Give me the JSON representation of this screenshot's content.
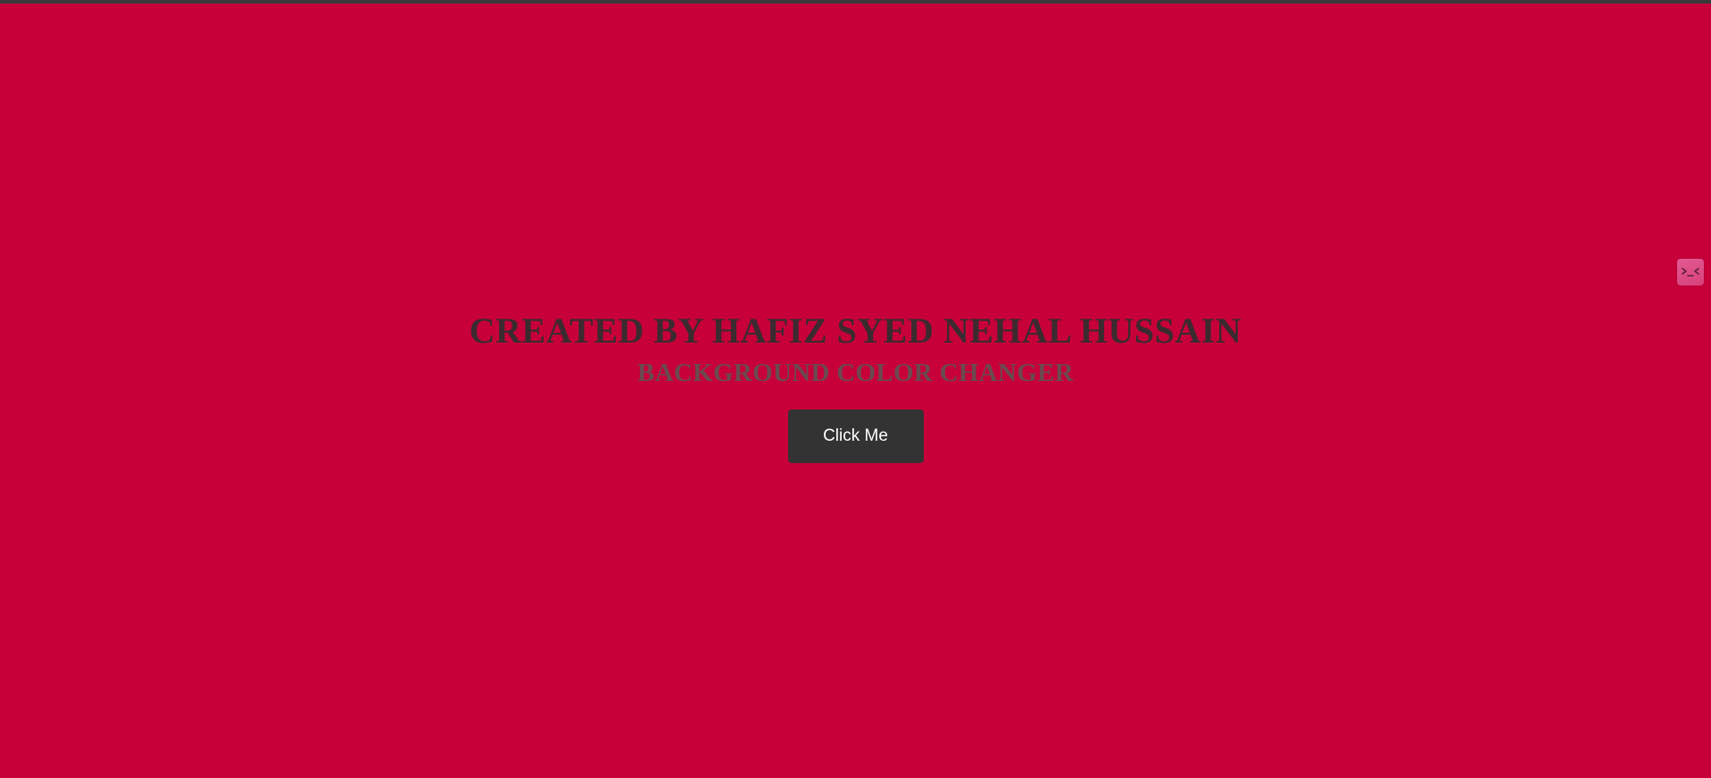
{
  "page": {
    "background_color": "#c70039",
    "title": "CREATED BY HAFIZ SYED NEHAL HUSSAIN",
    "subtitle": "BACKGROUND COLOR CHANGER",
    "button_label": "Click Me"
  },
  "extension_widget": {
    "icon": "face-icon"
  }
}
